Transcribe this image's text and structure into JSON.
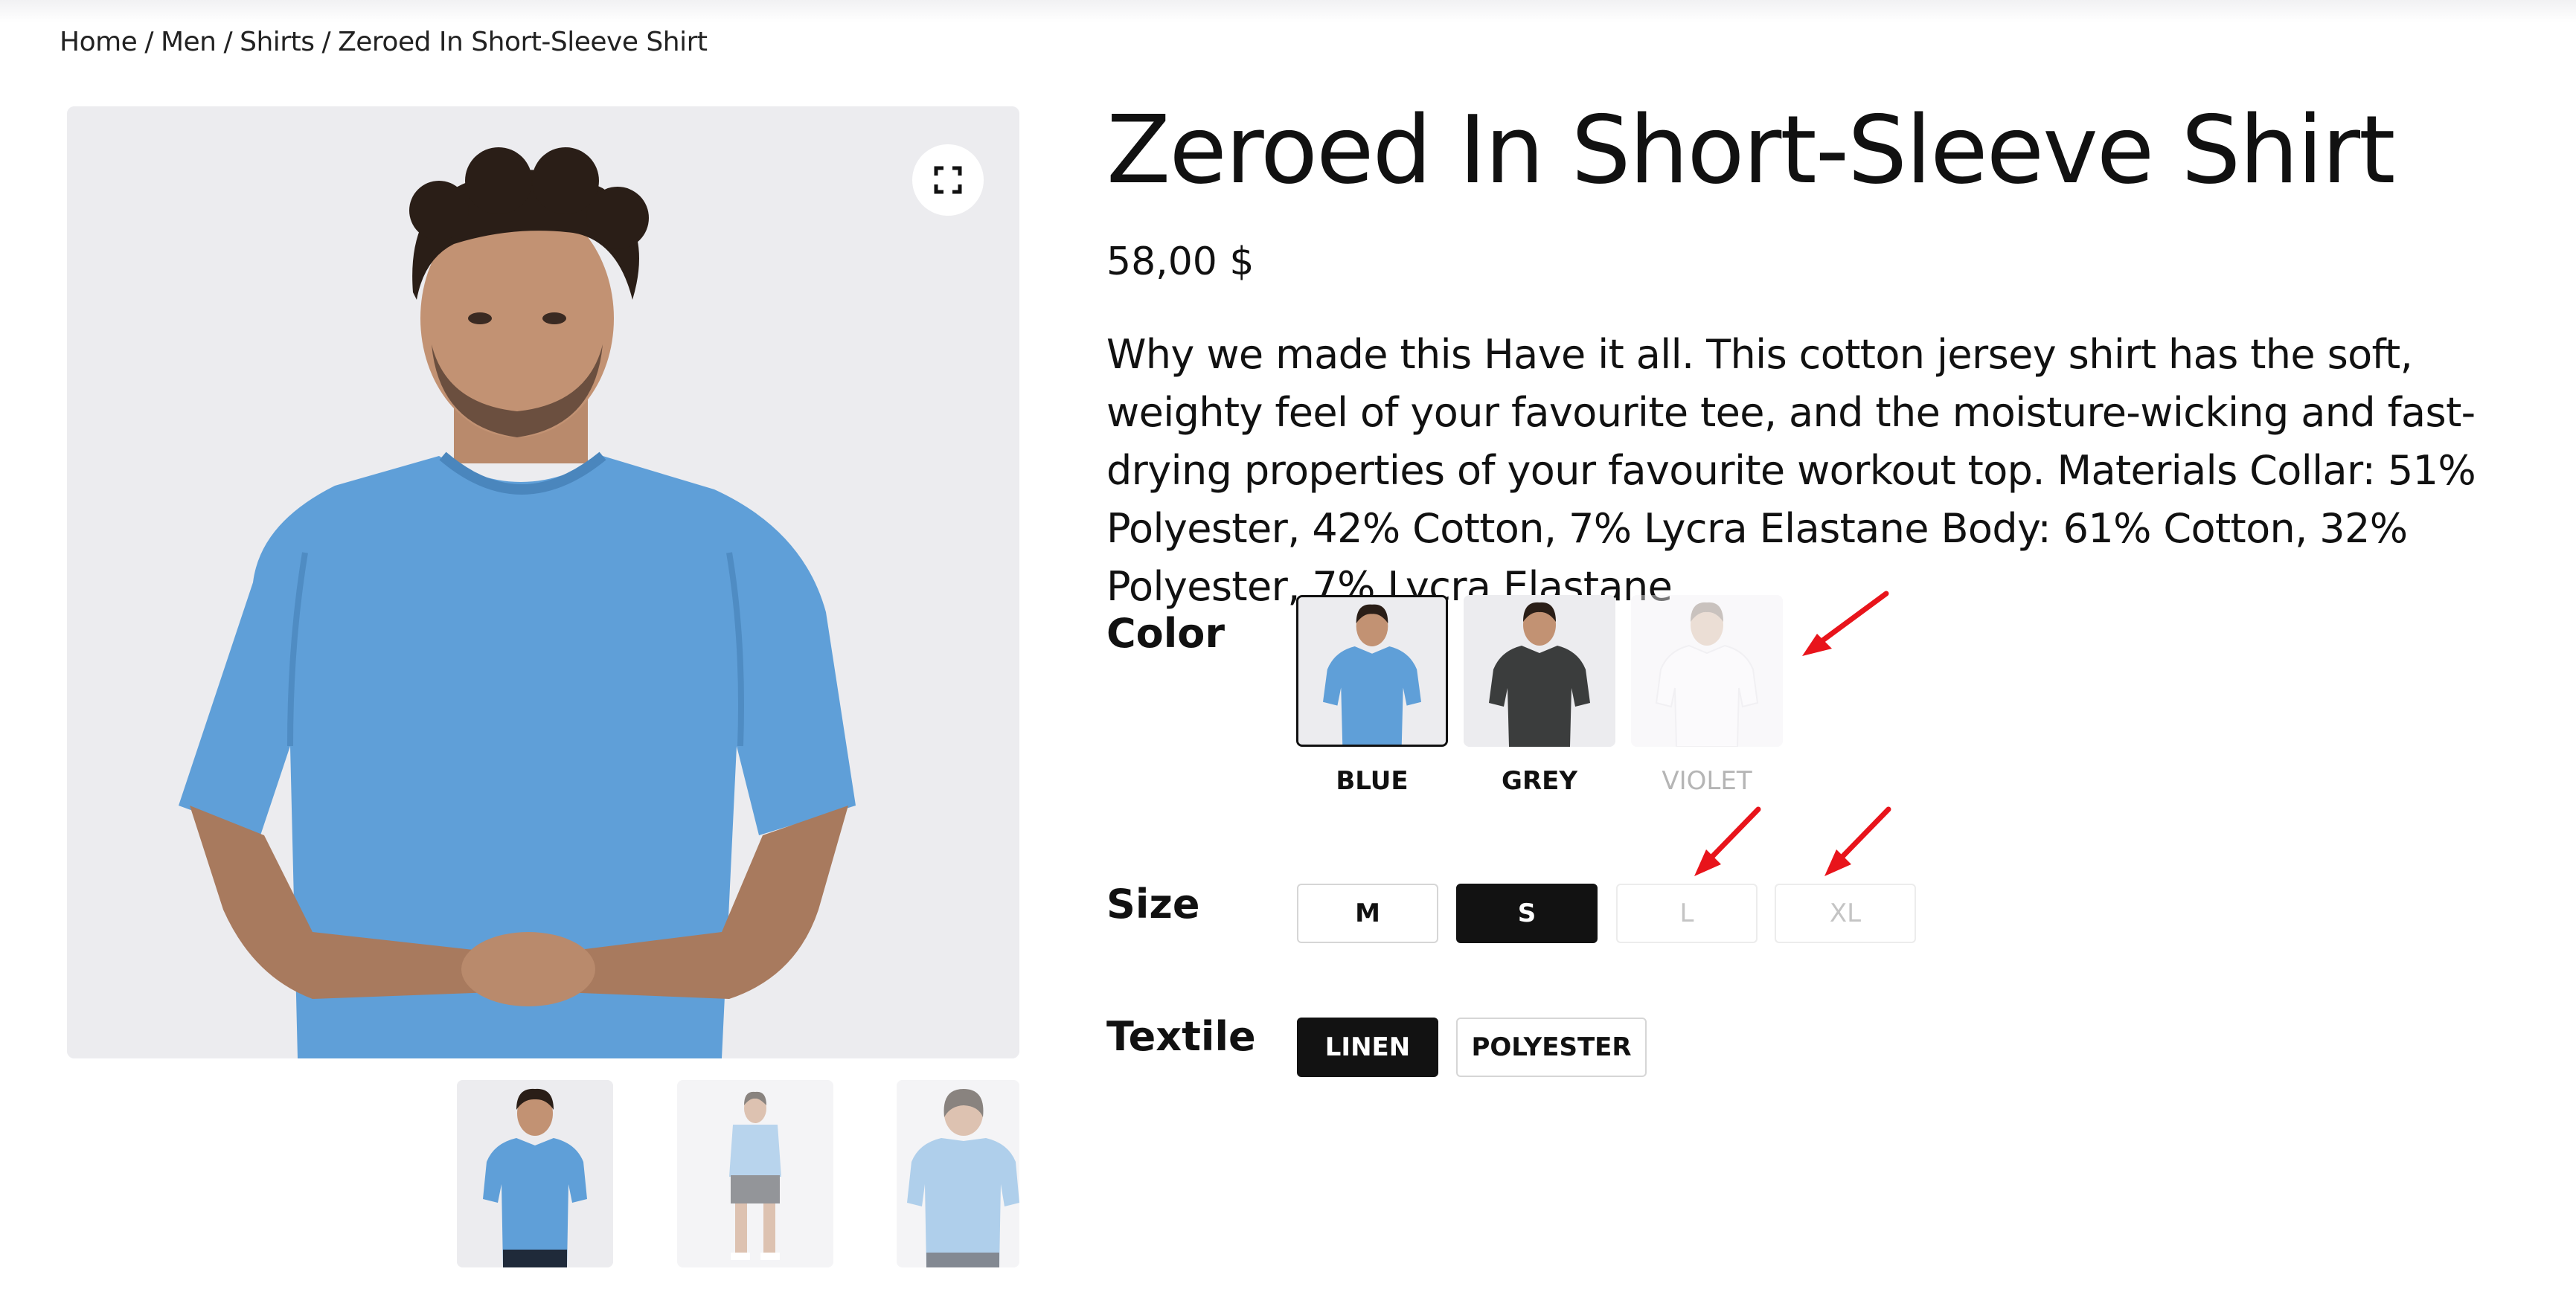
{
  "breadcrumb": {
    "items": [
      "Home",
      "Men",
      "Shirts",
      "Zeroed In Short-Sleeve Shirt"
    ],
    "separator": "/"
  },
  "product": {
    "title": "Zeroed In Short-Sleeve Shirt",
    "price": "58,00 $",
    "description": "Why we made this Have it all. This cotton jersey shirt has the soft, weighty feel of your favourite tee, and the moisture-wicking and fast-drying properties of your favourite workout top. Materials Collar: 51% Polyester, 42% Cotton, 7% Lycra Elastane Body: 61% Cotton, 32% Polyester, 7% Lycra Elastane"
  },
  "options": {
    "color": {
      "label": "Color",
      "swatches": [
        {
          "name": "BLUE",
          "shirt_color": "#5f9fd8",
          "state": "selected"
        },
        {
          "name": "GREY",
          "shirt_color": "#3b3d3d",
          "state": "available"
        },
        {
          "name": "VIOLET",
          "shirt_color": "#efebf3",
          "state": "disabled"
        }
      ]
    },
    "size": {
      "label": "Size",
      "values": [
        {
          "name": "M",
          "state": "available"
        },
        {
          "name": "S",
          "state": "selected"
        },
        {
          "name": "L",
          "state": "disabled"
        },
        {
          "name": "XL",
          "state": "disabled"
        }
      ]
    },
    "textile": {
      "label": "Textile",
      "values": [
        {
          "name": "LINEN",
          "state": "selected"
        },
        {
          "name": "POLYESTER",
          "state": "available"
        }
      ]
    }
  },
  "icons": {
    "expand": "expand-icon",
    "annotation": "red-arrow-icon"
  },
  "colors": {
    "text": "#111111",
    "selected_bg": "#121212",
    "disabled_text": "#c4c4c4",
    "annotation_arrow": "#e8141b",
    "image_bg": "#ececef",
    "shirt_blue": "#5f9fd8"
  }
}
